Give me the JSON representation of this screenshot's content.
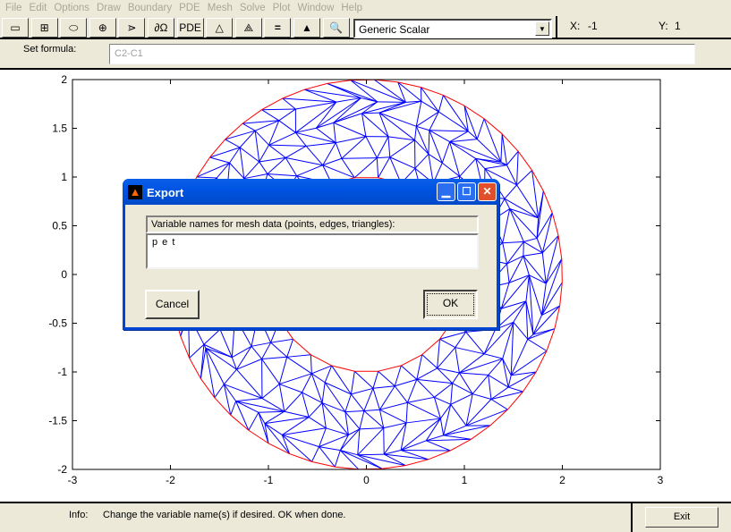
{
  "menu": [
    "File",
    "Edit",
    "Options",
    "Draw",
    "Boundary",
    "PDE",
    "Mesh",
    "Solve",
    "Plot",
    "Window",
    "Help"
  ],
  "toolbar": {
    "buttons": [
      {
        "name": "rectangle-icon",
        "label": ""
      },
      {
        "name": "centered-rectangle-icon",
        "label": ""
      },
      {
        "name": "ellipse-icon",
        "label": ""
      },
      {
        "name": "centered-ellipse-icon",
        "label": ""
      },
      {
        "name": "polygon-icon",
        "label": ""
      },
      {
        "name": "boundary-icon",
        "label": "∂Ω"
      },
      {
        "name": "pde-icon",
        "label": "PDE"
      },
      {
        "name": "init-mesh-icon",
        "label": ""
      },
      {
        "name": "refine-mesh-icon",
        "label": ""
      },
      {
        "name": "solve-icon",
        "label": "="
      },
      {
        "name": "plot-icon",
        "label": ""
      },
      {
        "name": "zoom-icon",
        "label": ""
      }
    ],
    "application_mode": "Generic Scalar",
    "x_label": "X:",
    "x_value": "-1",
    "y_label": "Y:",
    "y_value": "1"
  },
  "formula": {
    "label": "Set formula:",
    "value": "C2-C1"
  },
  "plot": {
    "x_ticks": [
      "-3",
      "-2",
      "-1",
      "0",
      "1",
      "2",
      "3"
    ],
    "y_ticks": [
      "2",
      "1.5",
      "1",
      "0.5",
      "0",
      "-0.5",
      "-1",
      "-1.5",
      "-2"
    ],
    "xlim": [
      -3,
      3
    ],
    "ylim": [
      -2,
      2
    ],
    "geometry": "annulus, inner radius 1, outer radius 2",
    "mesh_color": "#0000ff",
    "boundary_color": "#ff0000"
  },
  "dialog": {
    "title": "Export",
    "prompt": "Variable names for mesh data (points, edges, triangles):",
    "value": "p e t",
    "cancel": "Cancel",
    "ok": "OK"
  },
  "status": {
    "label": "Info:",
    "message": "Change the variable name(s) if desired. OK when done.",
    "exit": "Exit"
  }
}
